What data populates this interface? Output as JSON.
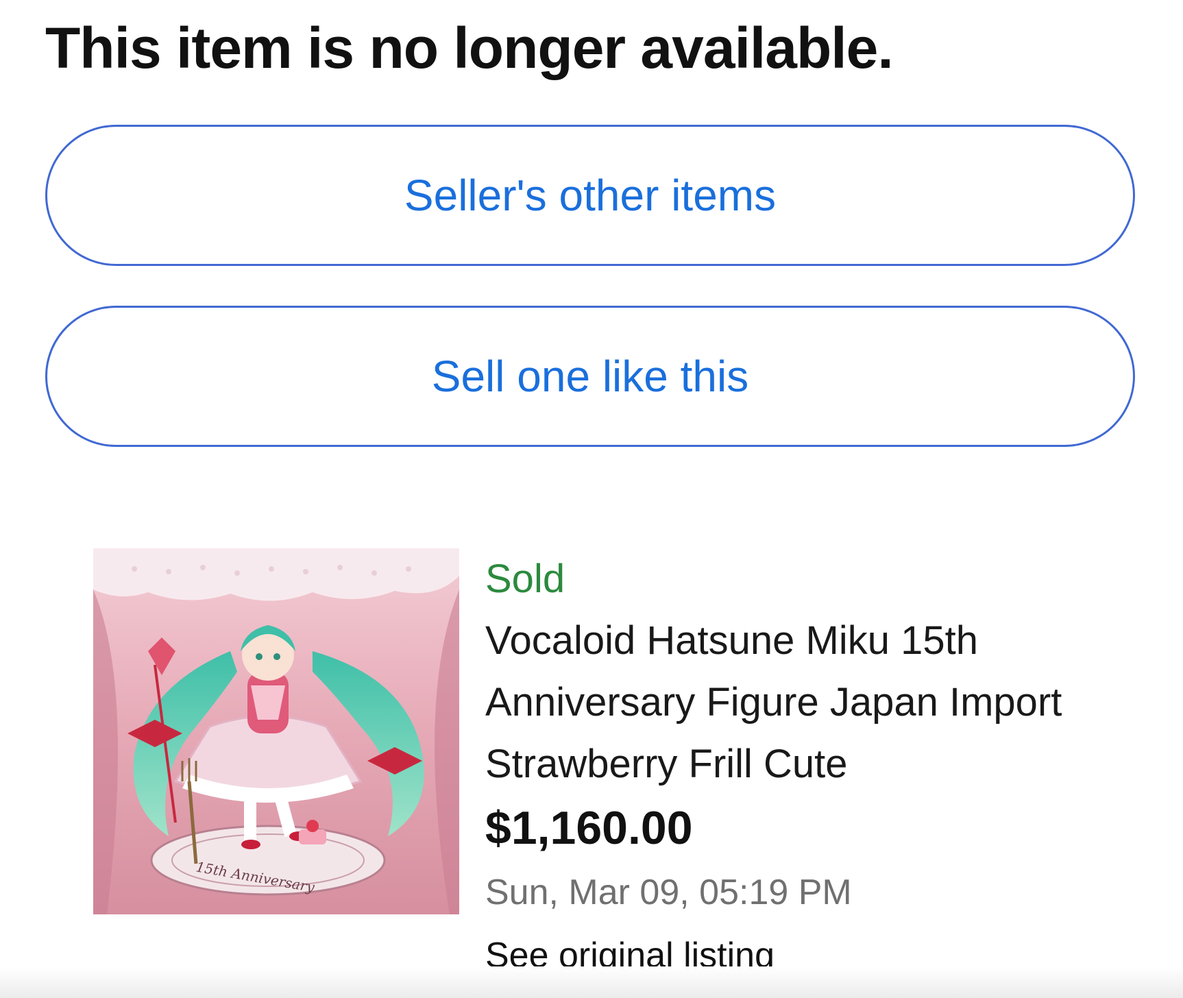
{
  "page": {
    "headline": "This item is no longer available."
  },
  "actions": {
    "sellers_other_items_label": "Seller's other items",
    "sell_one_like_this_label": "Sell one like this"
  },
  "listing": {
    "status": "Sold",
    "title": "Vocaloid Hatsune Miku 15th Anniversary Figure Japan Import Strawberry Frill Cute",
    "price": "$1,160.00",
    "date": "Sun, Mar 09, 05:19 PM",
    "link_label": "See original listing",
    "image": {
      "plate_text": "15th Anniversary"
    }
  },
  "colors": {
    "button_border": "#4169d3",
    "button_text": "#1a6fdc",
    "status_green": "#2b8a3e",
    "date_gray": "#707070",
    "thumb_background": "#e9b9c3"
  }
}
